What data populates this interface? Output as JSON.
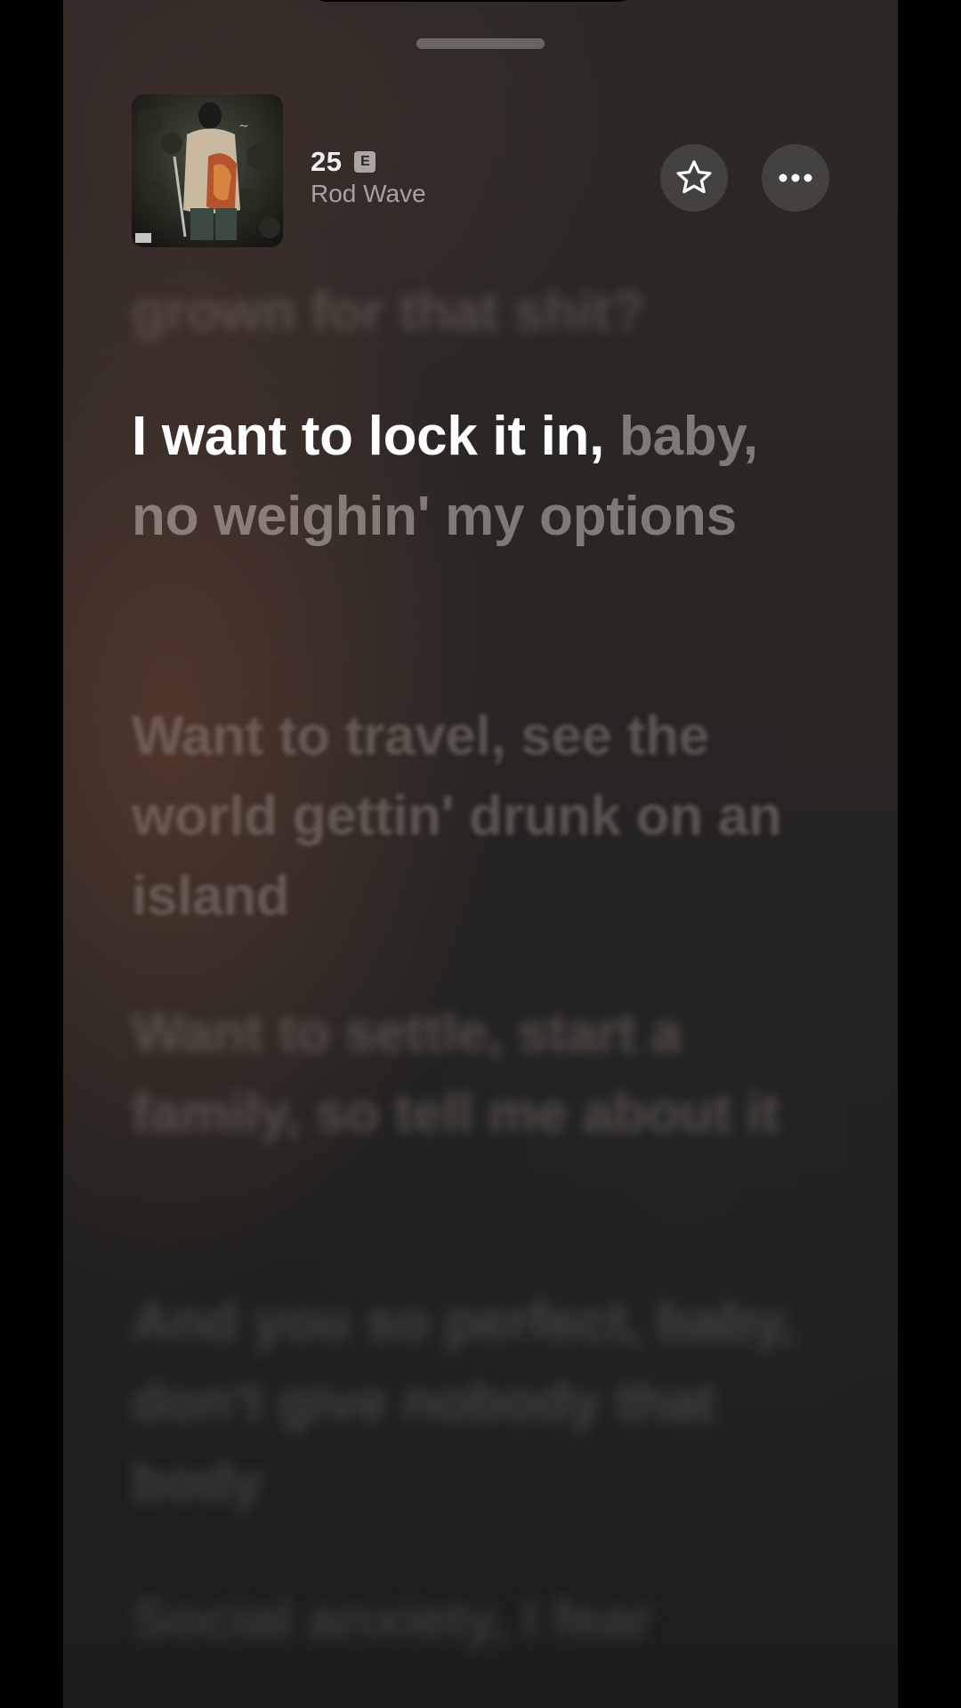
{
  "now_playing": {
    "title": "25",
    "explicit_label": "E",
    "artist": "Rod Wave",
    "favorite_icon": "star-icon",
    "more_icon": "more-horizontal-icon"
  },
  "lyrics": {
    "previous": "grown for that shit?",
    "current_sung": "I want to lock it in,",
    "current_unsung": "baby, no weighin' my options",
    "upcoming": [
      "Want to travel, see the world gettin' drunk on an island",
      "Want to settle, start a family, so tell me about it",
      "And you so perfect, baby, don't give nobody that body",
      "Social anxiety, I fear"
    ]
  }
}
